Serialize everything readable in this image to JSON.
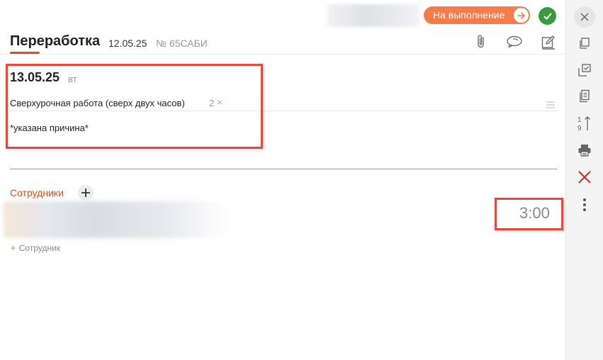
{
  "header": {
    "exec_button_label": "На выполнение",
    "title": "Переработка",
    "date": "12.05.25",
    "number": "№ 65САБИ"
  },
  "entry": {
    "date": "13.05.25",
    "day_of_week": "вт",
    "reason_type": "Сверхурочная работа (сверх двух часов)",
    "reason_count": "2",
    "reason_text": "*указана причина*"
  },
  "employees": {
    "label": "Сотрудники",
    "rows": [
      {
        "time": "3:00"
      }
    ],
    "add_label": "Сотрудник"
  },
  "colors": {
    "accent": "#f47b4a",
    "accent_text": "#d4501f",
    "ok": "#3a9a3c",
    "highlight": "#e04a3f"
  },
  "icons": {
    "header": [
      "paperclip-icon",
      "chat-icon",
      "edit-icon"
    ],
    "rightbar": [
      "close-icon",
      "copy-icon",
      "checklist-icon",
      "document-icon",
      "sort-icon",
      "print-icon",
      "delete-icon",
      "more-icon"
    ]
  }
}
